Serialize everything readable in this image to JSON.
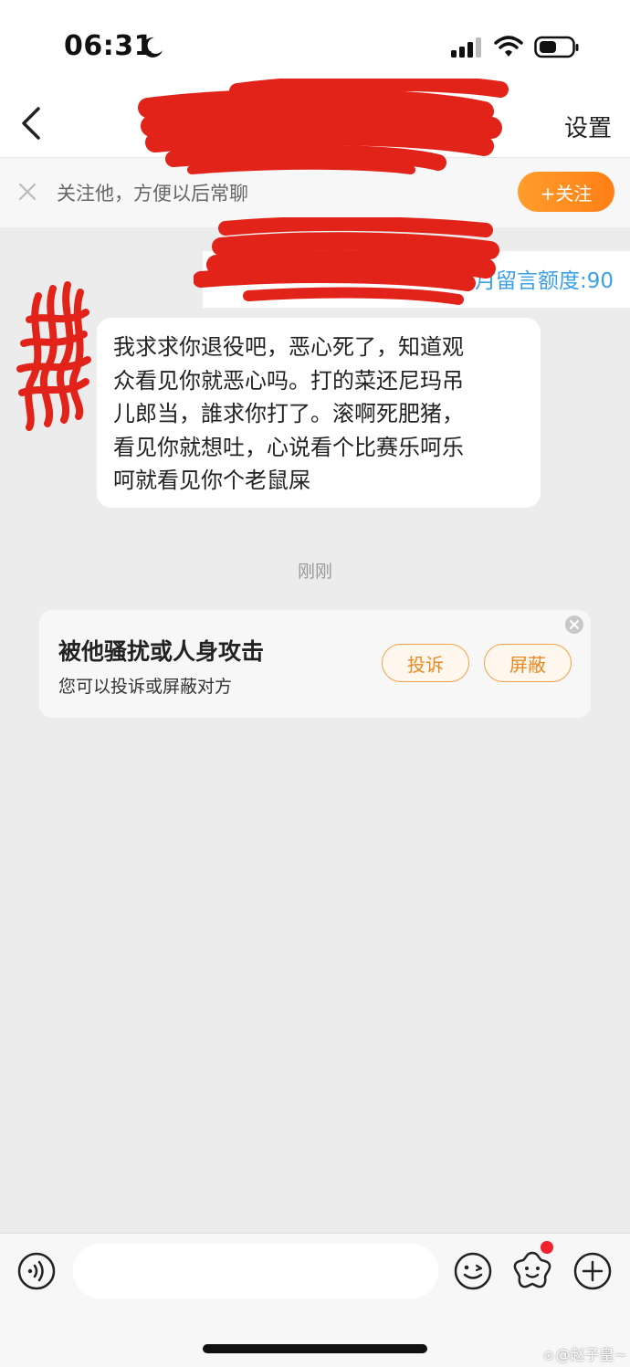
{
  "status_bar": {
    "time": "06:31"
  },
  "nav": {
    "settings_label": "设置"
  },
  "follow_bar": {
    "text": "关注他，方便以后常聊",
    "button_label": "+关注"
  },
  "quota": {
    "text": "本月留言额度:90"
  },
  "message": {
    "lines": [
      "我求求你退役吧，恶心死了，知道观",
      "众看见你就恶心吗。打的菜还尼玛吊",
      "儿郎当，誰求你打了。滚啊死肥猪，",
      "看见你就想吐，心说看个比赛乐呵乐",
      "呵就看见你个老鼠屎"
    ],
    "timestamp": "刚刚"
  },
  "harassment_card": {
    "title": "被他骚扰或人身攻击",
    "subtitle": "您可以投诉或屏蔽对方",
    "report_label": "投诉",
    "block_label": "屏蔽"
  },
  "watermark": "@赵子皇~",
  "colors": {
    "accent_orange": "#ff8a1f",
    "link_blue": "#3aa0e8",
    "redaction_red": "#e2231a",
    "notification_red": "#f0222c"
  },
  "icons": [
    "moon-icon",
    "signal-icon",
    "wifi-icon",
    "battery-icon",
    "back-arrow-icon",
    "close-icon",
    "voice-icon",
    "emoji-icon",
    "sticker-icon",
    "plus-icon"
  ]
}
